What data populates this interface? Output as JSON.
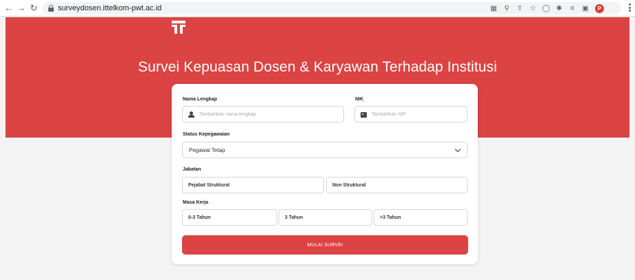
{
  "browser": {
    "url": "surveydosen.ittelkom-pwt.ac.id",
    "profile_initial": "P",
    "icons": [
      "translate-icon",
      "zoom-icon",
      "share-icon",
      "bookmark-star-icon",
      "extension-icon",
      "puzzle-icon",
      "reading-list-icon",
      "sidebar-icon"
    ]
  },
  "page": {
    "title": "Survei Kepuasan Dosen & Karyawan Terhadap Institusi",
    "brand_color": "#dc4343"
  },
  "form": {
    "nama_label": "Nama Lengkap",
    "nama_placeholder": "Tambahkan nama lengkap",
    "nik_label": "NIK",
    "nik_placeholder": "Tambahkan NIP",
    "status_label": "Status Kepegawaian",
    "status_value": "Pegawai Tetap",
    "jabatan_label": "Jabatan",
    "jabatan_options": [
      "Pejabat Struktural",
      "Non Struktural"
    ],
    "masa_label": "Masa Kerja",
    "masa_options": [
      "0-3 Tahun",
      "3 Tahun",
      ">3 Tahun"
    ],
    "submit_label": "MULAI SURVEI"
  }
}
